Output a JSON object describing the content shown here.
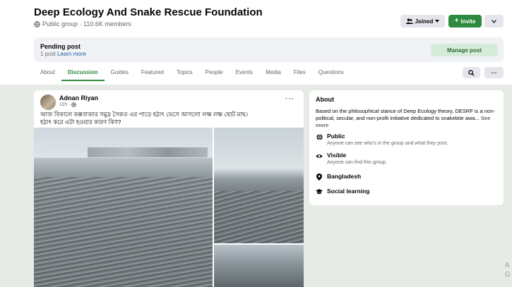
{
  "group": {
    "title": "Deep Ecology And Snake Rescue Foundation",
    "meta": "Public group · 110.6K members",
    "joined_label": "Joined",
    "invite_label": "Invite"
  },
  "pending": {
    "title": "Pending post",
    "count": "1 post",
    "learn_more": "Learn more",
    "manage_label": "Manage post"
  },
  "tabs": [
    "About",
    "Discussion",
    "Guides",
    "Featured",
    "Topics",
    "People",
    "Events",
    "Media",
    "Files",
    "Questions"
  ],
  "active_tab": "Discussion",
  "post": {
    "author": "Adnan Riyan",
    "time": "11h ·",
    "text_line1": "আজ বিকালে কক্সবাজার সমুদ্র সৈকত এর পাড়ে হঠাৎ ভেসে আসলো লক্ষ লক্ষ ছোট মাছ।",
    "text_line2": "হঠাৎ করে এটা হওয়ার কারণ কি??"
  },
  "about": {
    "title": "About",
    "description": "Based on the philosophical stance of Deep Ecology theory, DESRF is a non-political, secular, and non-profit initiative dedicated to snakebite awa...",
    "see_more": "See more",
    "public_label": "Public",
    "public_sub": "Anyone can see who's in the group and what they post.",
    "visible_label": "Visible",
    "visible_sub": "Anyone can find this group.",
    "location": "Bangladesh",
    "category": "Social learning"
  },
  "watermark": "A\nG",
  "colors": {
    "accent_green": "#2d8a3f",
    "background": "#e6ebe6"
  }
}
